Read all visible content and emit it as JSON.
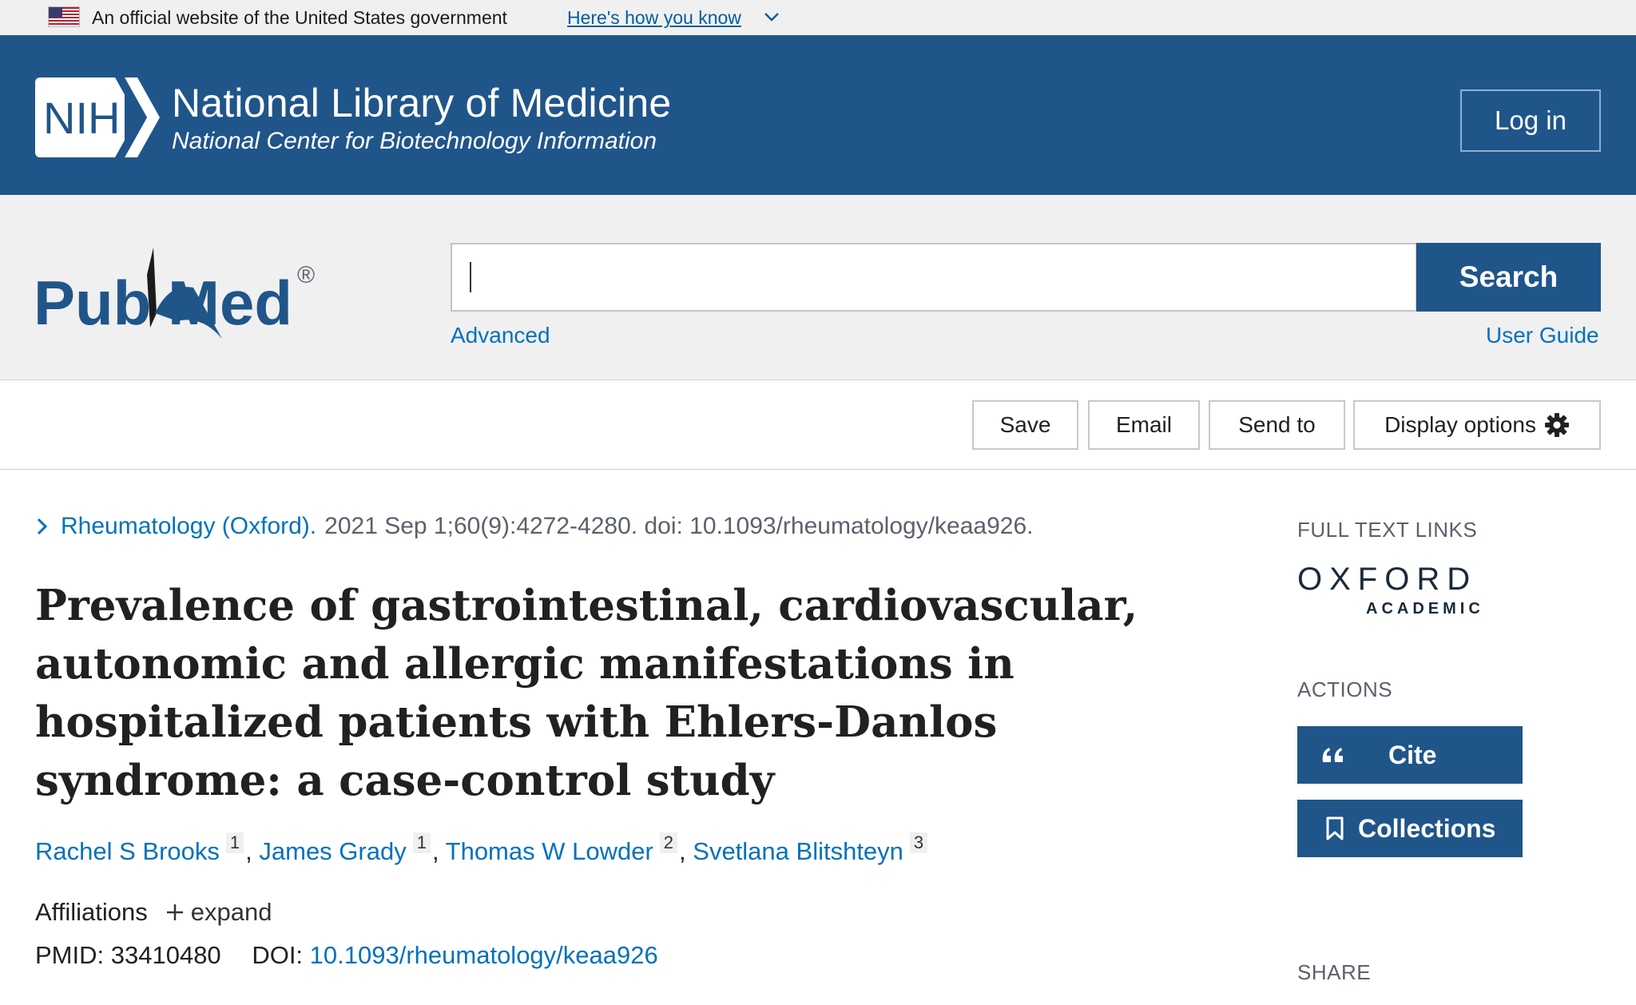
{
  "gov_banner": {
    "text": "An official website of the United States government",
    "link": "Here's how you know"
  },
  "nih_header": {
    "logo_text": "NIH",
    "title": "National Library of Medicine",
    "subtitle": "National Center for Biotechnology Information",
    "login_label": "Log in"
  },
  "pubmed": {
    "logo_pub": "Pub",
    "logo_med": "Med",
    "logo_reg": "®",
    "search_placeholder": "",
    "search_value": "",
    "search_label": "Search",
    "advanced_label": "Advanced",
    "user_guide_label": "User Guide"
  },
  "actions_bar": {
    "save": "Save",
    "email": "Email",
    "send_to": "Send to",
    "display_options": "Display options"
  },
  "article": {
    "journal": "Rheumatology (Oxford).",
    "citation": "2021 Sep 1;60(9):4272-4280. doi: 10.1093/rheumatology/keaa926.",
    "title": "Prevalence of gastrointestinal, cardiovascular, autonomic and allergic manifestations in hospitalized patients with Ehlers-Danlos syndrome: a case-control study",
    "authors": [
      {
        "name": "Rachel S Brooks",
        "aff": "1"
      },
      {
        "name": "James Grady",
        "aff": "1"
      },
      {
        "name": "Thomas W Lowder",
        "aff": "2"
      },
      {
        "name": "Svetlana Blitshteyn",
        "aff": "3"
      }
    ],
    "affiliations_label": "Affiliations",
    "expand_label": "expand",
    "pmid_label": "PMID:",
    "pmid": "33410480",
    "doi_label": "DOI:",
    "doi": "10.1093/rheumatology/keaa926"
  },
  "sidebar": {
    "full_text_heading": "FULL TEXT LINKS",
    "oxford_line1": "OXFORD",
    "oxford_line2": "ACADEMIC",
    "actions_heading": "ACTIONS",
    "cite_label": "Cite",
    "collections_label": "Collections",
    "share_heading": "SHARE"
  },
  "colors": {
    "nih_blue": "#20558a",
    "link_blue": "#0071bc",
    "banner_gray": "#f0f0f0"
  },
  "icons": [
    "us-flag-icon",
    "chevron-down-icon",
    "gear-icon",
    "chevron-right-icon",
    "plus-icon",
    "quote-icon",
    "bookmark-icon"
  ]
}
